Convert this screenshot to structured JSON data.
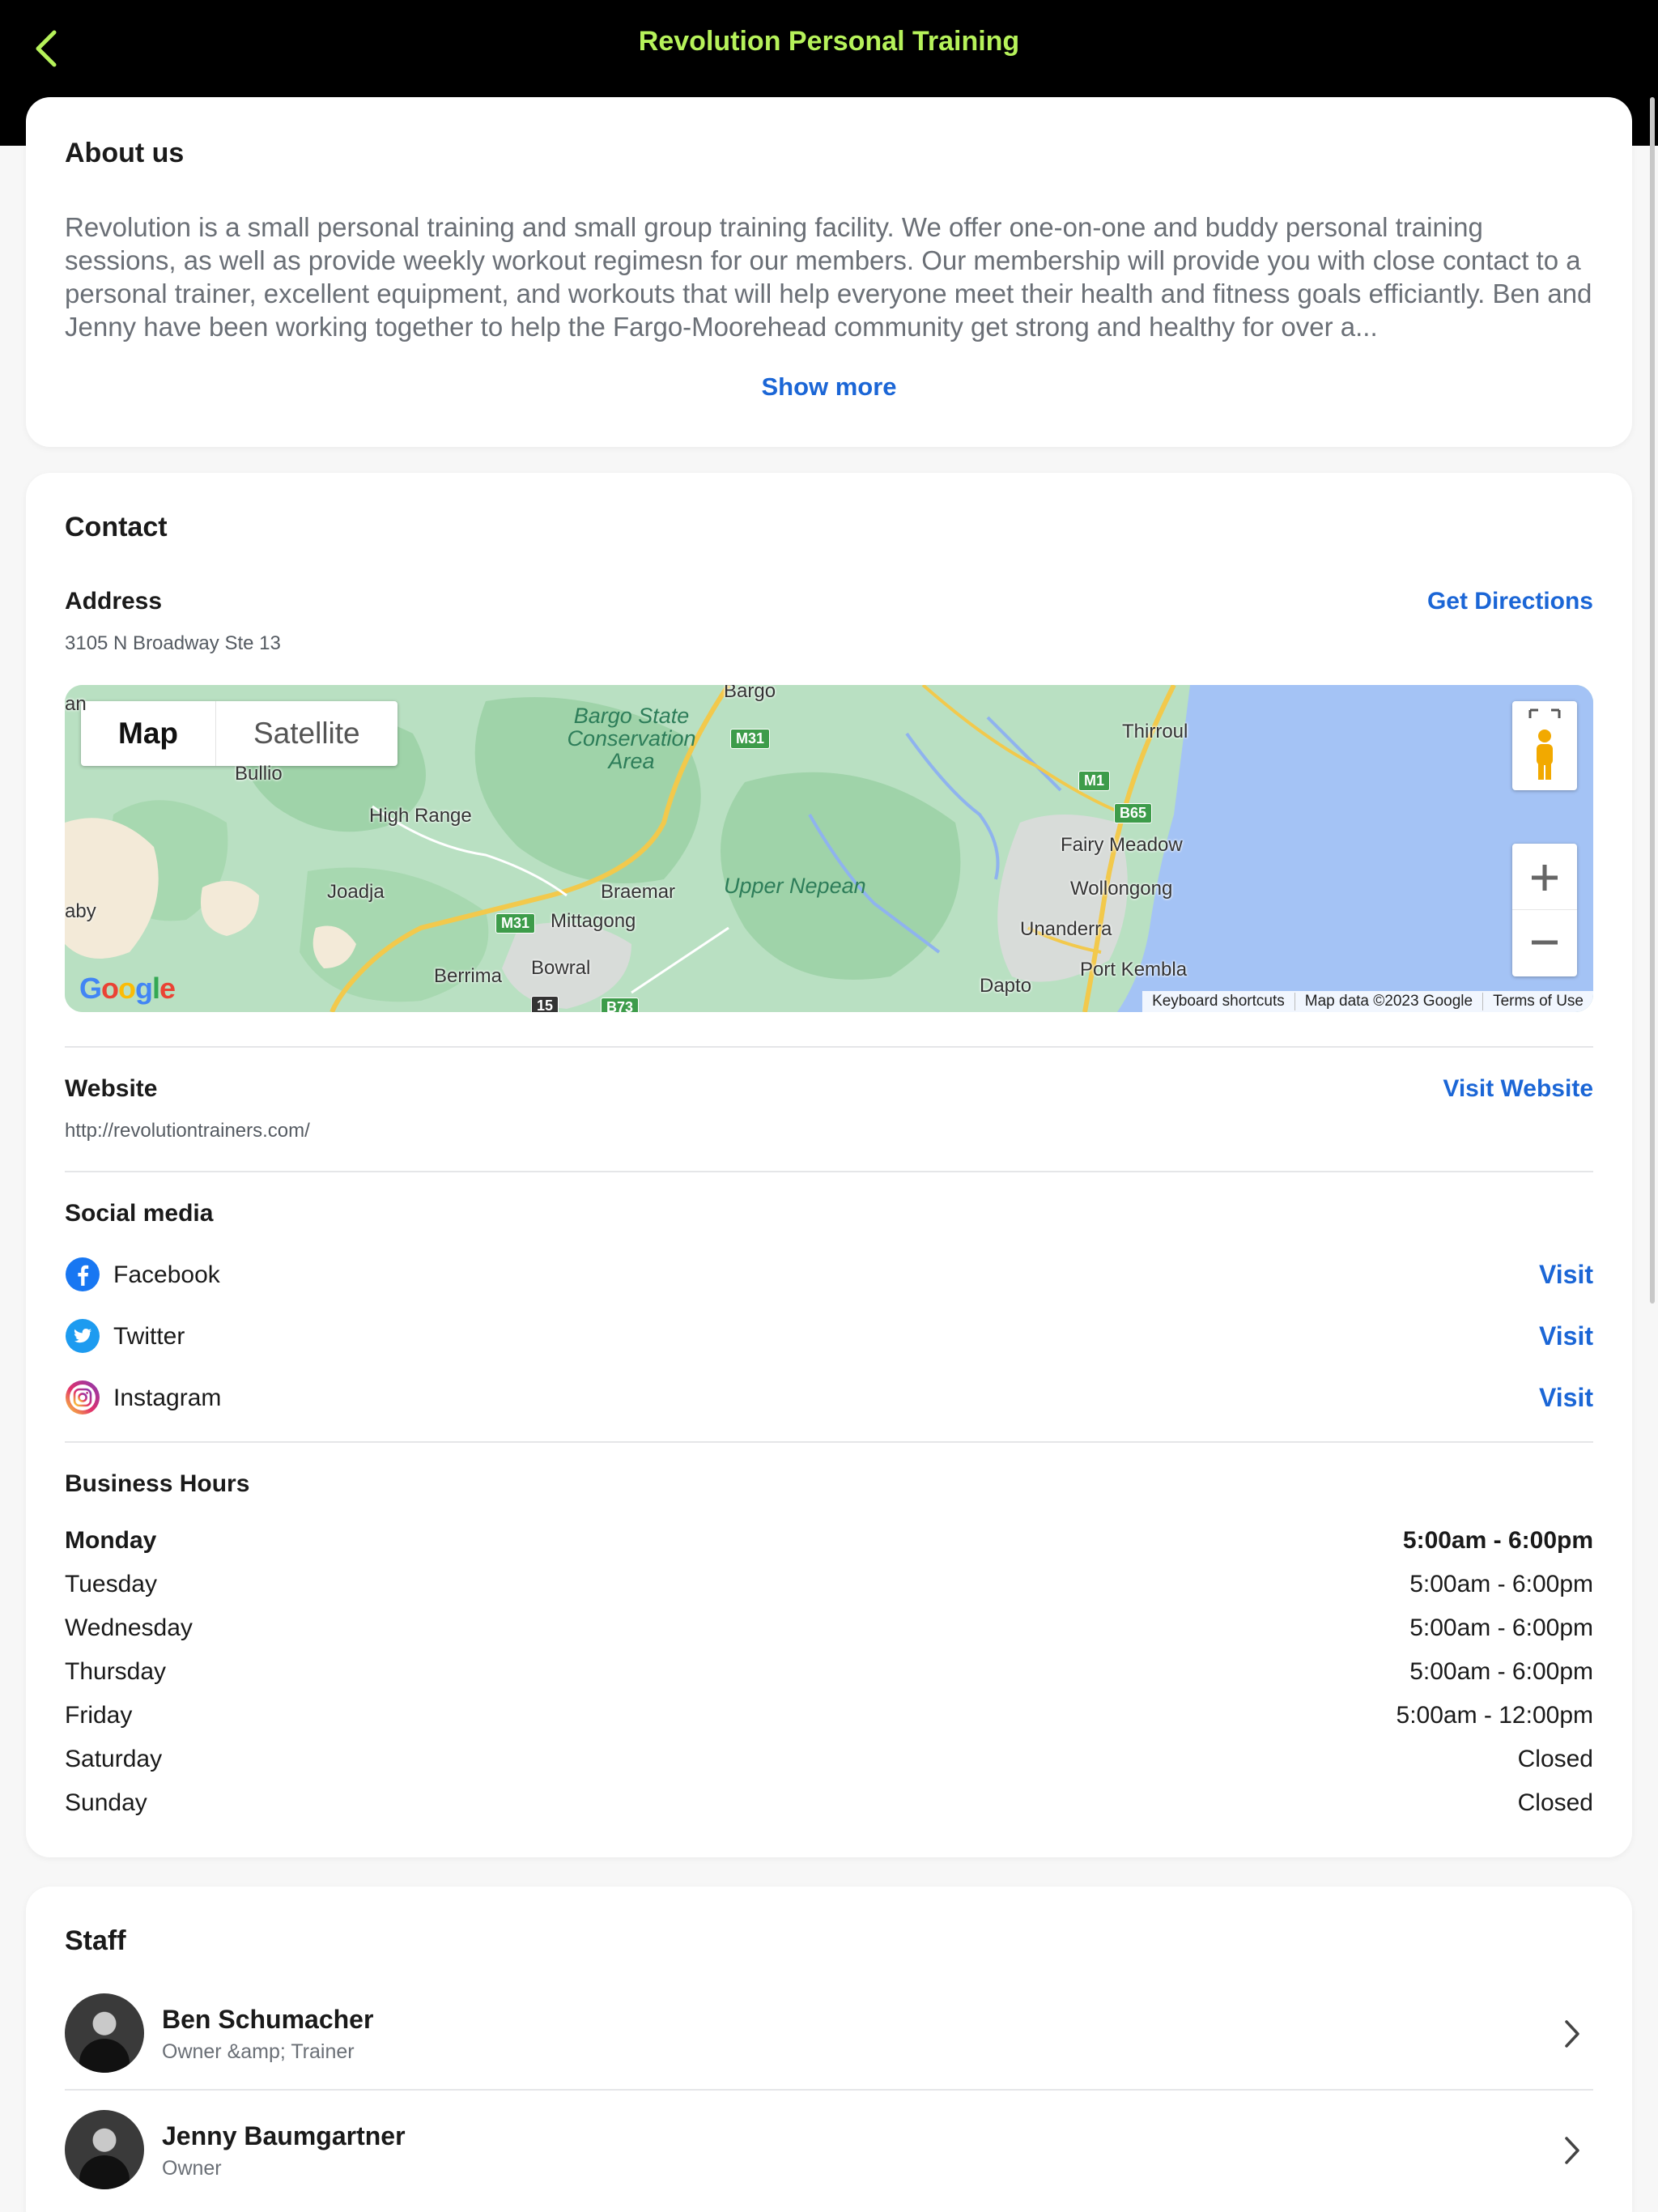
{
  "header": {
    "title": "Revolution Personal Training",
    "accent_color": "#b6f25a",
    "back_icon": "chevron-left-icon"
  },
  "about": {
    "title": "About us",
    "body": "Revolution is a small personal training and small group training facility.  We offer one-on-one and buddy personal training sessions, as well as provide weekly workout regimesn for our members.  Our membership will provide you with close contact to a personal trainer, excellent equipment, and workouts that will help everyone meet their health and fitness goals efficiantly.  Ben and Jenny have been working together to help the Fargo-Moorehead community get strong and healthy for over a...",
    "show_more": "Show more"
  },
  "contact": {
    "title": "Contact",
    "address_label": "Address",
    "address_value": "3105 N Broadway Ste 13",
    "directions_link": "Get Directions",
    "map": {
      "toggle_map": "Map",
      "toggle_satellite": "Satellite",
      "places": {
        "bargo": "Bargo",
        "area1": "Bargo State",
        "area2": "Conservation",
        "area3": "Area",
        "thirroul": "Thirroul",
        "bullio": "Bullio",
        "high_range": "High Range",
        "joadja": "Joadja",
        "braemar": "Braemar",
        "upper_nepean": "Upper Nepean",
        "fairy_meadow": "Fairy Meadow",
        "wollongong": "Wollongong",
        "unanderra": "Unanderra",
        "mittagong": "Mittagong",
        "bowral": "Bowral",
        "berrima": "Berrima",
        "port_kembla": "Port Kembla",
        "dapto": "Dapto",
        "edge_an": "an",
        "edge_aby": "aby"
      },
      "shields": {
        "m31_a": "M31",
        "m31_b": "M31",
        "m1": "M1",
        "b65": "B65",
        "r15": "15",
        "b73": "B73"
      },
      "google_logo": "Google",
      "footer_shortcuts": "Keyboard shortcuts",
      "footer_data": "Map data ©2023 Google",
      "footer_terms": "Terms of Use",
      "water_color": "#a4c3f5",
      "land_color": "#b9e0c2"
    },
    "website_label": "Website",
    "website_value": "http://revolutiontrainers.com/",
    "website_link": "Visit Website",
    "social_title": "Social media",
    "social": [
      {
        "name": "Facebook",
        "action": "Visit",
        "icon": "facebook-icon",
        "color": "#1877f2"
      },
      {
        "name": "Twitter",
        "action": "Visit",
        "icon": "twitter-icon",
        "color": "#1d9bf0"
      },
      {
        "name": "Instagram",
        "action": "Visit",
        "icon": "instagram-icon",
        "color": "#e1306c"
      }
    ],
    "hours_title": "Business Hours",
    "hours": [
      {
        "day": "Monday",
        "time": "5:00am - 6:00pm"
      },
      {
        "day": "Tuesday",
        "time": "5:00am - 6:00pm"
      },
      {
        "day": "Wednesday",
        "time": "5:00am - 6:00pm"
      },
      {
        "day": "Thursday",
        "time": "5:00am - 6:00pm"
      },
      {
        "day": "Friday",
        "time": "5:00am - 12:00pm"
      },
      {
        "day": "Saturday",
        "time": "Closed"
      },
      {
        "day": "Sunday",
        "time": "Closed"
      }
    ]
  },
  "staff": {
    "title": "Staff",
    "members": [
      {
        "name": "Ben Schumacher",
        "role": "Owner &amp; Trainer"
      },
      {
        "name": "Jenny Baumgartner",
        "role": "Owner"
      }
    ]
  },
  "link_color": "#1b66d6"
}
